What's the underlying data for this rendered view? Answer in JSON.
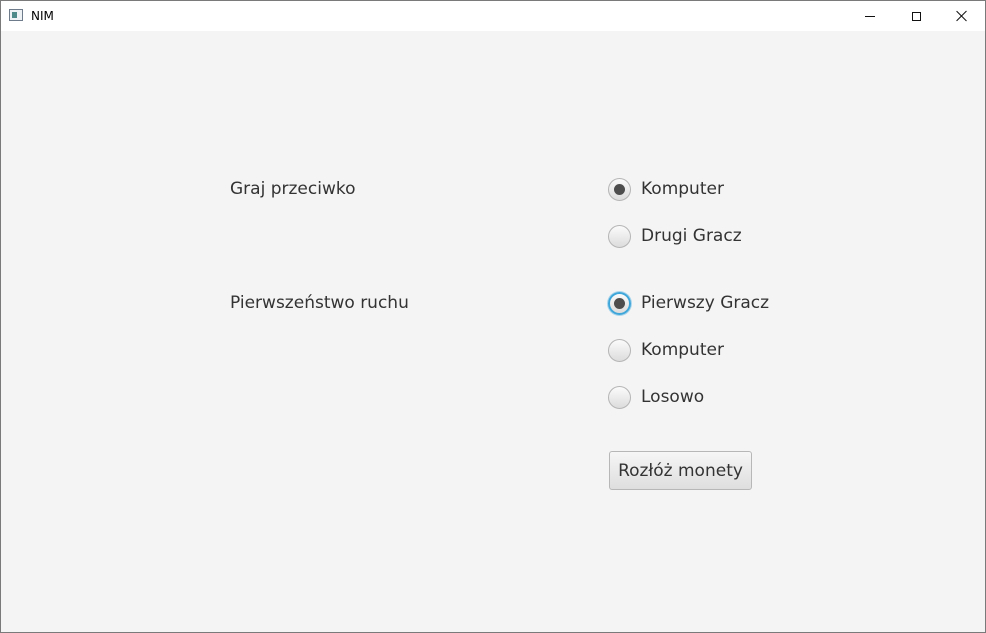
{
  "window": {
    "title": "NIM"
  },
  "opponent": {
    "label": "Graj przeciwko",
    "options": [
      {
        "label": "Komputer",
        "selected": true
      },
      {
        "label": "Drugi Gracz",
        "selected": false
      }
    ]
  },
  "first_move": {
    "label": "Pierwszeństwo ruchu",
    "options": [
      {
        "label": "Pierwszy Gracz",
        "selected": true
      },
      {
        "label": "Komputer",
        "selected": false
      },
      {
        "label": "Losowo",
        "selected": false
      }
    ]
  },
  "deal_button": {
    "label": "Rozłóż monety"
  }
}
